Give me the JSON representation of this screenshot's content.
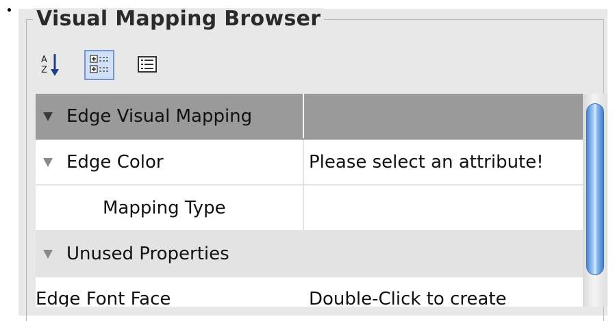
{
  "panel": {
    "title": "Visual Mapping Browser"
  },
  "toolbar": {
    "buttons": [
      {
        "icon": "sort-alphabetically-icon",
        "selected": false
      },
      {
        "icon": "categorized-view-icon",
        "selected": true
      },
      {
        "icon": "description-view-icon",
        "selected": false
      }
    ]
  },
  "properties": {
    "rows": [
      {
        "type": "category",
        "expanded": true,
        "label": "Edge Visual Mapping",
        "value": ""
      },
      {
        "type": "property",
        "expanded": true,
        "label": "Edge Color",
        "value": "Please select an attribute!"
      },
      {
        "type": "child",
        "label": "Mapping Type",
        "value": ""
      },
      {
        "type": "section",
        "expanded": true,
        "label": "Unused Properties",
        "value": ""
      },
      {
        "type": "property",
        "label": "Edge Font Face",
        "value": "Double-Click to create"
      }
    ]
  },
  "colors": {
    "header_row": "#9a9a9a",
    "section_row": "#e3e3e3",
    "scrollbar_thumb": "#6ea7e8",
    "selected_button_border": "#6d97d4"
  }
}
